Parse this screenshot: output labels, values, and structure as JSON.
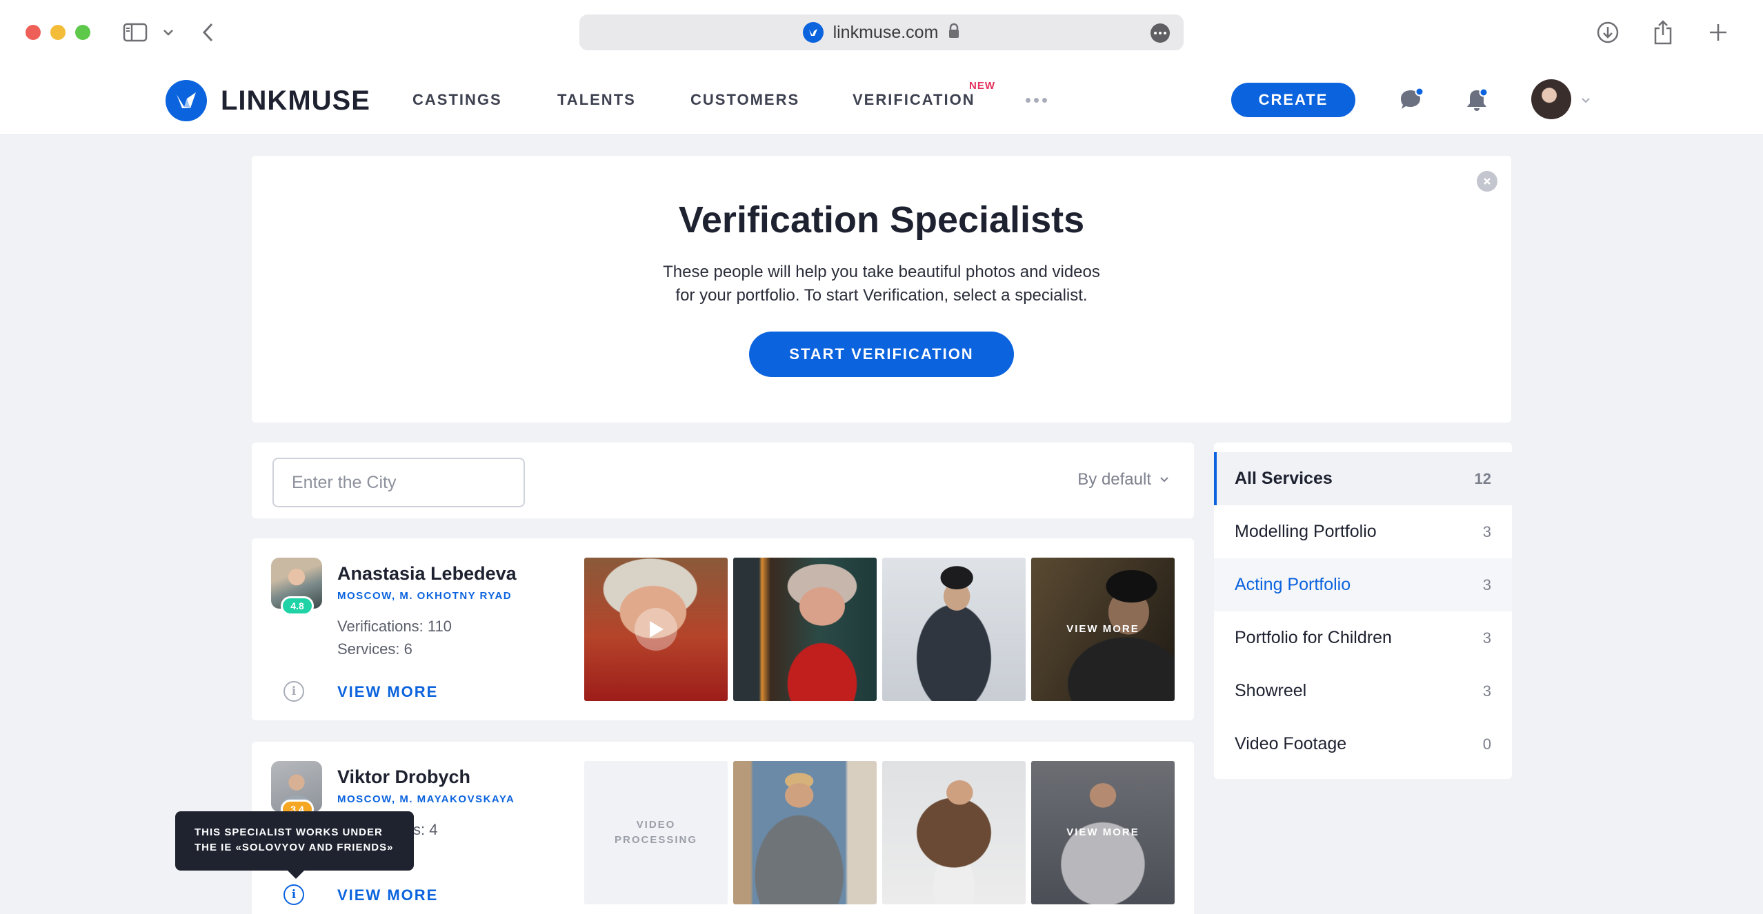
{
  "browser": {
    "url": "linkmuse.com"
  },
  "header": {
    "logo_text": "LINKMUSE",
    "nav": [
      {
        "label": "CASTINGS"
      },
      {
        "label": "TALENTS"
      },
      {
        "label": "CUSTOMERS"
      },
      {
        "label": "VERIFICATION",
        "badge": "NEW"
      }
    ],
    "create_label": "CREATE"
  },
  "hero": {
    "title": "Verification Specialists",
    "desc_line1": "These people will help you take beautiful photos and videos",
    "desc_line2": "for your portfolio. To start Verification, select a specialist.",
    "button": "START VERIFICATION"
  },
  "filter": {
    "city_placeholder": "Enter the City",
    "sort_label": "By default"
  },
  "specialists": [
    {
      "name": "Anastasia Lebedeva",
      "rating": "4.8",
      "rating_color": "#1fd3a6",
      "location": "MOSCOW, M. OKHOTNY RYAD",
      "verifications": "Verifications: 110",
      "services": "Services: 6",
      "view_more": "VIEW MORE",
      "thumb_overlay": "VIEW MORE"
    },
    {
      "name": "Viktor Drobych",
      "rating": "3.4",
      "rating_color": "#f5a623",
      "location": "MOSCOW, M. MAYAKOVSKAYA",
      "services_partial": "s: 4",
      "view_more": "VIEW MORE",
      "video_processing_1": "VIDEO",
      "video_processing_2": "PROCESSING",
      "thumb_overlay": "VIEW MORE"
    }
  ],
  "tooltip": {
    "line1": "THIS SPECIALIST WORKS UNDER",
    "line2": "THE IE «SOLOVYOV AND FRIENDS»"
  },
  "services": [
    {
      "label": "All Services",
      "count": "12"
    },
    {
      "label": "Modelling Portfolio",
      "count": "3"
    },
    {
      "label": "Acting Portfolio",
      "count": "3"
    },
    {
      "label": "Portfolio for Children",
      "count": "3"
    },
    {
      "label": "Showreel",
      "count": "3"
    },
    {
      "label": "Video Footage",
      "count": "0"
    }
  ],
  "colors": {
    "accent": "#0b63de",
    "new_badge": "#e4315d",
    "tooltip_bg": "#1f2330"
  }
}
